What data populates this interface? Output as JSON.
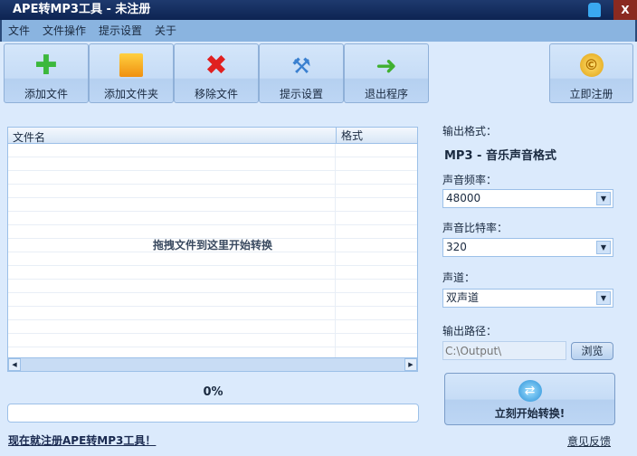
{
  "window": {
    "title": "APE转MP3工具 - 未注册",
    "close": "X"
  },
  "menu": [
    "文件",
    "文件操作",
    "提示设置",
    "关于"
  ],
  "toolbar": [
    {
      "label": "添加文件",
      "icon": "plus-icon",
      "color": "#3cb83c"
    },
    {
      "label": "添加文件夹",
      "icon": "folder-icon",
      "color": "#f0a020"
    },
    {
      "label": "移除文件",
      "icon": "x-icon",
      "color": "#e02020"
    },
    {
      "label": "提示设置",
      "icon": "tools-icon",
      "color": "#3a80d0"
    },
    {
      "label": "退出程序",
      "icon": "arrow-right-icon",
      "color": "#40b030"
    }
  ],
  "register_button": {
    "label": "立即注册",
    "icon": "coin-icon"
  },
  "file_list": {
    "columns": [
      "文件名",
      "格式"
    ],
    "empty_hint": "拖拽文件到这里开始转换"
  },
  "progress": {
    "text": "0%",
    "value": 0
  },
  "register_link": "现在就注册APE转MP3工具！",
  "settings": {
    "format_label": "输出格式：",
    "format_value": "MP3 - 音乐声音格式",
    "freq_label": "声音频率：",
    "freq_value": "48000",
    "bitrate_label": "声音比特率：",
    "bitrate_value": "320",
    "channel_label": "声道：",
    "channel_value": "双声道",
    "path_label": "输出路径：",
    "path_placeholder": "C:\\Output\\",
    "browse": "浏览"
  },
  "start_button": "立刻开始转换!",
  "feedback_link": "意见反馈"
}
